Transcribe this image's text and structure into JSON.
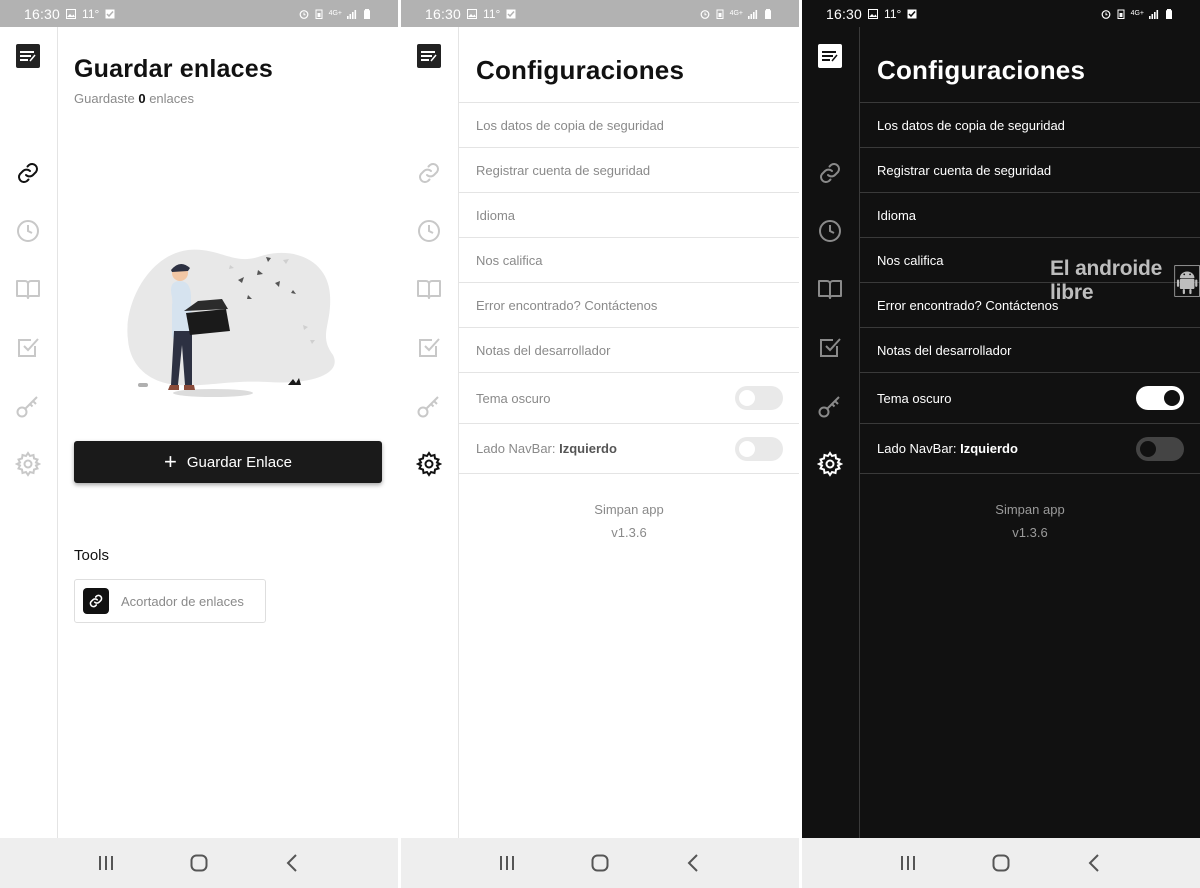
{
  "status_bar": {
    "time": "16:30",
    "temperature": "11°",
    "network": "4G+"
  },
  "home": {
    "title": "Guardar enlaces",
    "subtitle_prefix": "Guardaste",
    "subtitle_count": "0",
    "subtitle_suffix": "enlaces",
    "save_button_label": "Guardar Enlace",
    "tools_heading": "Tools",
    "tool_item_label": "Acortador de enlaces"
  },
  "settings": {
    "title": "Configuraciones",
    "items": [
      "Los datos de copia de seguridad",
      "Registrar cuenta de seguridad",
      "Idioma",
      "Nos califica",
      "Error encontrado? Contáctenos",
      "Notas del desarrollador"
    ],
    "dark_theme_label": "Tema oscuro",
    "navbar_side_label": "Lado NavBar:",
    "navbar_side_value": "Izquierdo",
    "app_name": "Simpan app",
    "app_version": "v1.3.6",
    "light_panel": {
      "dark_theme_on": false,
      "navbar_toggle_on": false
    },
    "dark_panel": {
      "dark_theme_on": true,
      "navbar_toggle_on": false
    }
  },
  "watermark": {
    "text": "El androide libre"
  },
  "rail_icons": [
    "notes-logo-icon",
    "link-icon",
    "clock-icon",
    "book-icon",
    "checkbox-icon",
    "key-icon",
    "gear-icon"
  ],
  "nav_icons": [
    "recents-icon",
    "home-icon",
    "back-icon"
  ],
  "colors": {
    "dark_bg": "#111111",
    "accent_dark": "#1a1a1a",
    "muted_text": "#8a8a8a"
  }
}
